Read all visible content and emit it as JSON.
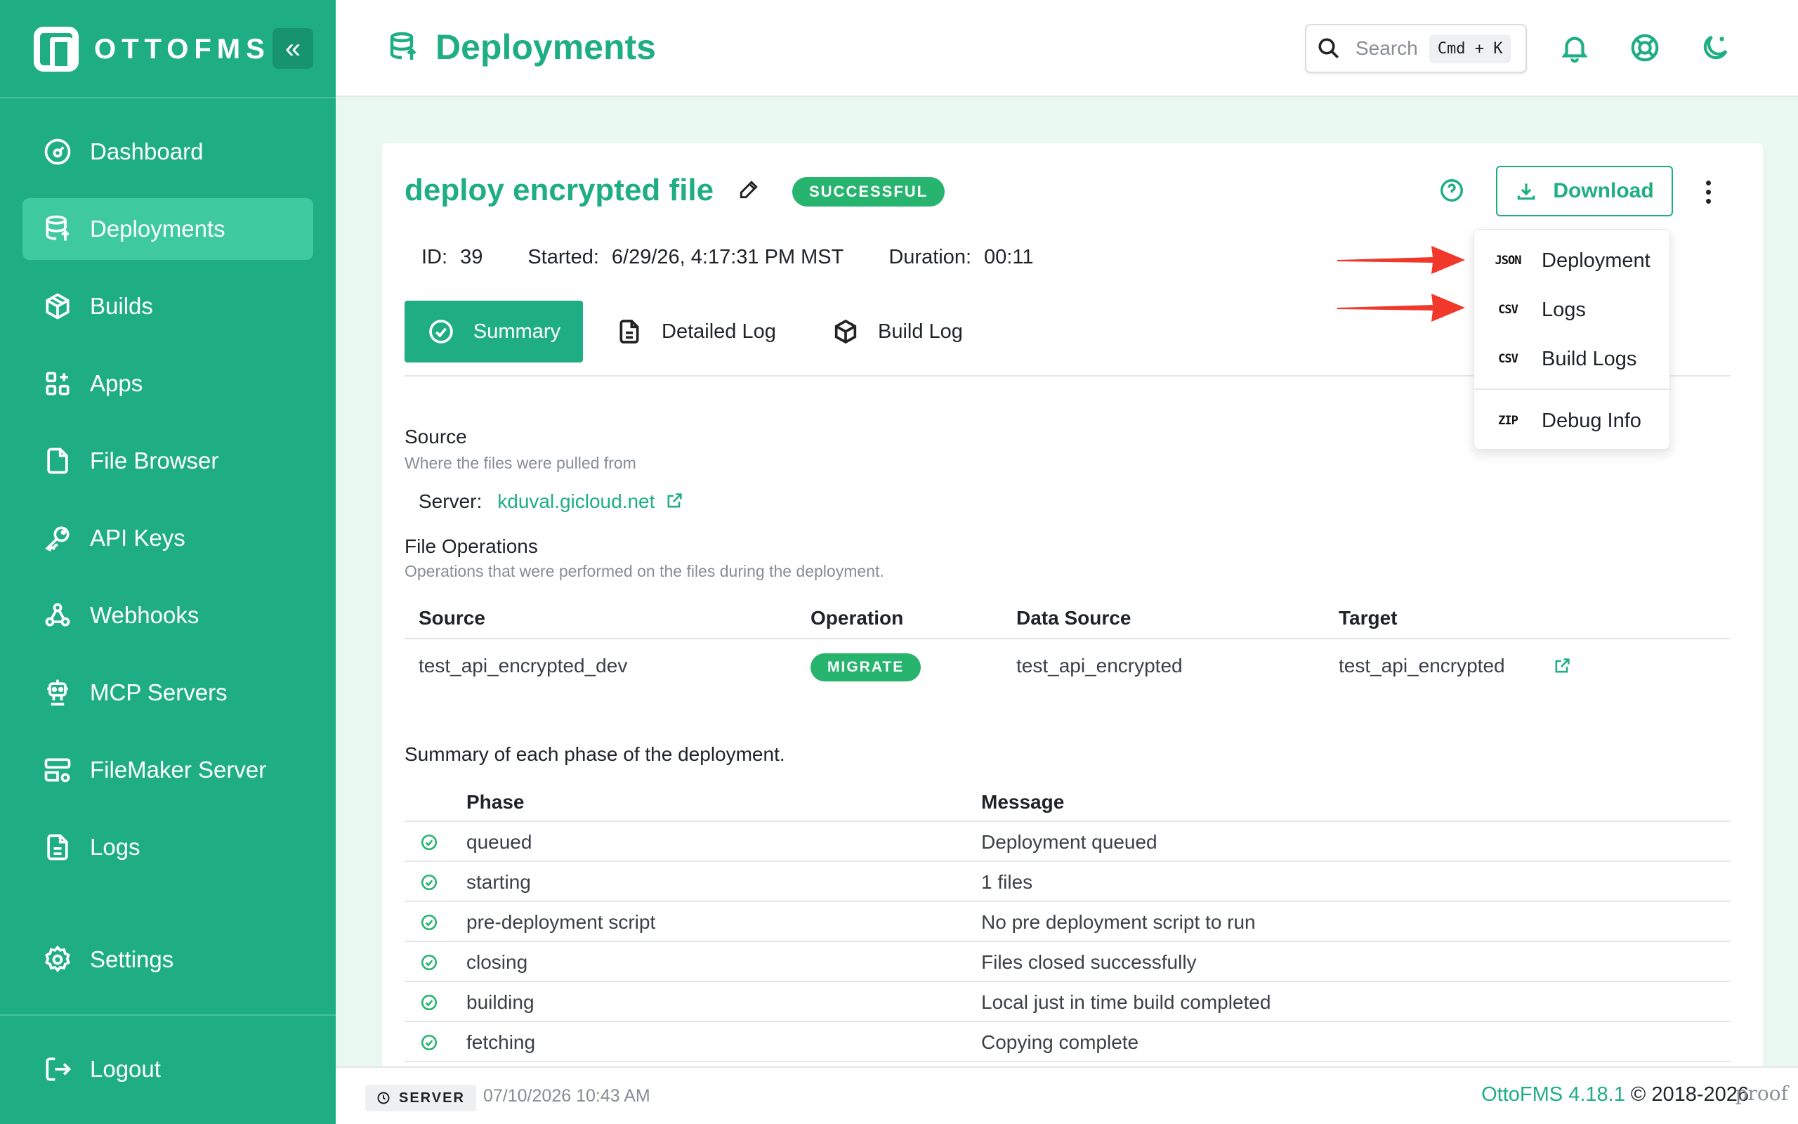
{
  "brand": {
    "name": "OTTOFMS",
    "collapse_icon": "«"
  },
  "sidebar": {
    "items": [
      {
        "label": "Dashboard",
        "icon": "gauge-icon"
      },
      {
        "label": "Deployments",
        "icon": "database-upload-icon",
        "active": true
      },
      {
        "label": "Builds",
        "icon": "box-icon"
      },
      {
        "label": "Apps",
        "icon": "apps-grid-icon"
      },
      {
        "label": "File Browser",
        "icon": "file-icon"
      },
      {
        "label": "API Keys",
        "icon": "key-icon"
      },
      {
        "label": "Webhooks",
        "icon": "webhook-icon"
      },
      {
        "label": "MCP Servers",
        "icon": "robot-icon"
      },
      {
        "label": "FileMaker Server",
        "icon": "server-gear-icon"
      },
      {
        "label": "Logs",
        "icon": "document-icon"
      }
    ],
    "settings": "Settings",
    "logout": "Logout"
  },
  "header": {
    "title": "Deployments",
    "search_placeholder": "Search",
    "shortcut": "Cmd + K"
  },
  "deployment": {
    "name": "deploy encrypted file",
    "status": "SUCCESSFUL",
    "id_label": "ID:",
    "id": "39",
    "started_label": "Started:",
    "started": "6/29/26, 4:17:31 PM MST",
    "duration_label": "Duration:",
    "duration": "00:11",
    "download_label": "Download"
  },
  "tabs": [
    {
      "label": "Summary",
      "active": true
    },
    {
      "label": "Detailed Log"
    },
    {
      "label": "Build Log"
    }
  ],
  "download_menu": [
    {
      "tag": "JSON",
      "label": "Deployment"
    },
    {
      "tag": "CSV",
      "label": "Logs"
    },
    {
      "tag": "CSV",
      "label": "Build Logs"
    },
    {
      "tag": "ZIP",
      "label": "Debug Info"
    }
  ],
  "source": {
    "title": "Source",
    "subtitle": "Where the files were pulled from",
    "server_label": "Server:",
    "server": "kduval.gicloud.net"
  },
  "file_operations": {
    "title": "File Operations",
    "subtitle": "Operations that were performed on the files during the deployment.",
    "columns": [
      "Source",
      "Operation",
      "Data Source",
      "Target"
    ],
    "rows": [
      {
        "source": "test_api_encrypted_dev",
        "operation": "MIGRATE",
        "data_source": "test_api_encrypted",
        "target": "test_api_encrypted"
      }
    ]
  },
  "phases": {
    "title": "Summary of each phase of the deployment.",
    "columns": [
      "Phase",
      "Message"
    ],
    "rows": [
      {
        "phase": "queued",
        "message": "Deployment queued"
      },
      {
        "phase": "starting",
        "message": "1 files"
      },
      {
        "phase": "pre-deployment script",
        "message": "No pre deployment script to run"
      },
      {
        "phase": "closing",
        "message": "Files closed successfully"
      },
      {
        "phase": "building",
        "message": "Local just in time build completed"
      },
      {
        "phase": "fetching",
        "message": "Copying complete"
      }
    ]
  },
  "footer": {
    "server_chip": "SERVER",
    "server_time": "07/10/2026 10:43 AM",
    "version": "OttoFMS 4.18.1",
    "copyright": "© 2018-2026",
    "proof": "proof"
  },
  "colors": {
    "brand_green": "#1fae83",
    "status_green": "#27b46e",
    "annotation_red": "#f0382b"
  }
}
